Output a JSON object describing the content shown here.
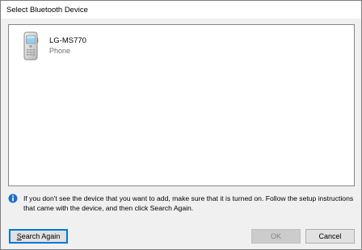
{
  "window": {
    "title": "Select Bluetooth Device"
  },
  "devices": [
    {
      "name": "LG-MS770",
      "type": "Phone",
      "icon": "mobile-phone-icon"
    }
  ],
  "info": {
    "icon": "info-icon",
    "text": "If you don't see the device that you want to add, make sure that it is turned on. Follow the setup instructions that came with the device, and then click Search Again."
  },
  "buttons": {
    "search_again_accel": "S",
    "search_again_rest": "earch Again",
    "ok": "OK",
    "cancel": "Cancel"
  },
  "colors": {
    "accent": "#0078d7",
    "info_blue": "#1e6fc6"
  }
}
